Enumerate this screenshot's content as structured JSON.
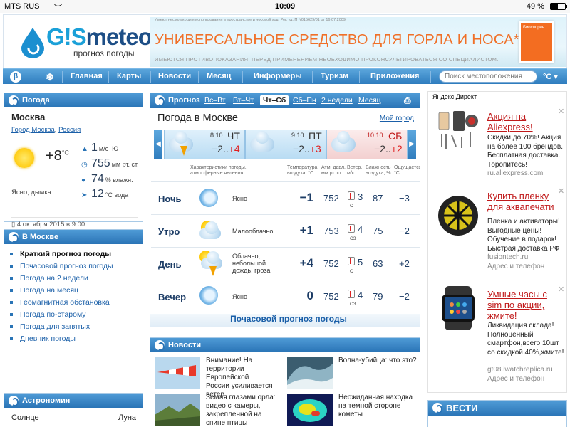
{
  "status_bar": {
    "carrier": "MTS RUS",
    "time": "10:09",
    "battery": "49 %",
    "battery_level": 0.49
  },
  "header": {
    "logo_text_a": "G!S",
    "logo_text_b": "meteo",
    "logo_sub": "прогноз погоды",
    "ad_small": "Имеют несколько для использования в пространстве и носовой ход. Рег. уд. П N015629/01 от 16.07.2009",
    "ad_title": "УНИВЕРСАЛЬНОЕ СРЕДСТВО ДЛЯ ГОРЛА И НОСА*",
    "ad_warning": "ИМЕЮТСЯ ПРОТИВОПОКАЗАНИЯ. ПЕРЕД ПРИМЕНЕНИЕМ НЕОБХОДИМО ПРОКОНСУЛЬТИРОВАТЬСЯ СО СПЕЦИАЛИСТОМ.",
    "ad_box_text": "Биоспорин"
  },
  "nav": {
    "items": [
      "Главная",
      "Карты",
      "Новости",
      "Месяц",
      "Информеры",
      "Туризм",
      "Приложения"
    ],
    "search_placeholder": "Поиск местоположения",
    "unit": "°C ▾",
    "btn_a": "β",
    "btn_b": "❄"
  },
  "weather_now": {
    "header": "Погода",
    "city": "Москва",
    "region_a": "Город Москва",
    "region_b": "Россия",
    "temp": "+8",
    "temp_unit": "°C",
    "condition": "Ясно, дымка",
    "wind_value": "1",
    "wind_unit": "м/с",
    "wind_dir": "Ю",
    "pressure_value": "755",
    "pressure_unit": "мм рт. ст.",
    "humidity_value": "74",
    "humidity_unit": "% влажн.",
    "water_value": "12",
    "water_unit": "°С вода",
    "date": "4 октября 2015 в 9:00"
  },
  "in_moscow": {
    "header": "В Москве",
    "items": [
      "Краткий прогноз погоды",
      "Почасовой прогноз погоды",
      "Погода на 2 недели",
      "Погода на месяц",
      "Геомагнитная обстановка",
      "Погода по-старому",
      "Погода для занятых",
      "Дневник погоды"
    ]
  },
  "astronomy": {
    "header": "Астрономия",
    "sun": "Солнце",
    "moon": "Луна"
  },
  "forecast": {
    "header": "Прогноз",
    "tabs": [
      "Вс–Вт",
      "Вт–Чт",
      "Чт–Сб",
      "Сб–Пн",
      "2 недели",
      "Месяц"
    ],
    "title": "Погода в Москве",
    "my_city": "Мой город",
    "days": [
      {
        "date": "8.10",
        "name": "ЧТ",
        "min": "−2..",
        "max": "+4"
      },
      {
        "date": "9.10",
        "name": "ПТ",
        "min": "−2..",
        "max": "+3"
      },
      {
        "date": "10.10",
        "name": "СБ",
        "min": "−2..",
        "max": "+2"
      }
    ],
    "columns": [
      "Характеристики погоды, атмосферные явления",
      "Температура воздуха, °C",
      "Атм. давл. мм рт. ст.",
      "Ветер, м/с",
      "Влажность воздуха, %",
      "Ощущается, °C"
    ],
    "rows": [
      {
        "name": "Ночь",
        "desc": "Ясно",
        "temp": "−1",
        "pressure": "752",
        "wind": "3",
        "dir": "С",
        "humidity": "87",
        "feels": "−3"
      },
      {
        "name": "Утро",
        "desc": "Малооблачно",
        "temp": "+1",
        "pressure": "753",
        "wind": "4",
        "dir": "СЗ",
        "humidity": "75",
        "feels": "−2"
      },
      {
        "name": "День",
        "desc": "Облачно, небольшой дождь, гроза",
        "temp": "+4",
        "pressure": "752",
        "wind": "5",
        "dir": "С",
        "humidity": "63",
        "feels": "+2"
      },
      {
        "name": "Вечер",
        "desc": "Ясно",
        "temp": "0",
        "pressure": "752",
        "wind": "4",
        "dir": "СЗ",
        "humidity": "79",
        "feels": "−2"
      }
    ],
    "hourly_link": "Почасовой прогноз погоды"
  },
  "news": {
    "header": "Новости",
    "items": [
      {
        "text": "Внимание! На территории Европейской России усиливается ветер"
      },
      {
        "text": "Волна-убийца: что это?"
      },
      {
        "text": "Земля глазами орла: видео с камеры, закрепленной на спине птицы"
      },
      {
        "text": "Неожиданная находка на темной стороне кометы"
      }
    ]
  },
  "ads": {
    "label": "Яндекс.Директ",
    "items": [
      {
        "title": "Акция на Aliexpress!",
        "body": "Скидки до 70%! Акция на более 100 брендов. Бесплатная доставка. Торопитесь!",
        "url": "ru.aliexpress.com"
      },
      {
        "title": "Купить пленку для аквапечати",
        "body": "Пленка и активаторы! Выгодные цены! Обучение в подарок! Быстрая доставка РФ",
        "url": "fusiontech.ru",
        "extra": "Адрес и телефон"
      },
      {
        "title": "Умные часы с sim по акции, жмите!",
        "body": "Ликвидация склада! Полноценный смартфон,всего 10шт со скидкой 40%,жмите!",
        "url": "gt08.iwatchreplica.ru",
        "extra": "Адрес и телефон"
      }
    ],
    "vesti": "ВЕСТИ"
  }
}
